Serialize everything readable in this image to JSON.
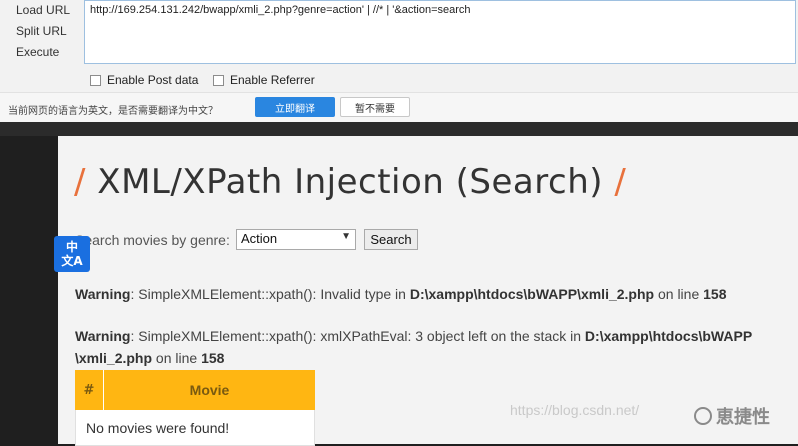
{
  "hackbar": {
    "actions": [
      "Load URL",
      "Split URL",
      "Execute"
    ],
    "url": "http://169.254.131.242/bwapp/xmli_2.php?genre=action' | //* | '&action=search",
    "options": [
      "Enable Post data",
      "Enable Referrer"
    ]
  },
  "translate_bar": {
    "prompt": "当前网页的语言为英文，是否需要翻译为中文？",
    "translate_button": "立即翻译",
    "not_now_button": "暂不需要"
  },
  "page": {
    "title": "XML/XPath Injection (Search)",
    "title_slash": "/",
    "search_label": "Search movies by genre:",
    "genre_selected": "Action",
    "search_button": "Search",
    "warnings": [
      {
        "label": "Warning",
        "message": ": SimpleXMLElement::xpath(): Invalid type in ",
        "path": "D:\\xampp\\htdocs\\bWAPP\\xmli_2.php",
        "on_line": " on line ",
        "line": "158"
      },
      {
        "label": "Warning",
        "message": ": SimpleXMLElement::xpath(): xmlXPathEval: 3 object left on the stack in ",
        "path_part1": "D:\\xampp\\htdocs\\bWAPP",
        "path_part2": "\\xmli_2.php",
        "on_line": " on line ",
        "line": "158"
      }
    ],
    "table": {
      "headers": [
        "#",
        "Movie"
      ],
      "empty_message": "No movies were found!"
    }
  },
  "translate_badge": {
    "top": "中",
    "bottom": "文A"
  },
  "watermark": {
    "url": "https://blog.csdn.net/",
    "logo_text": "恵捷性"
  },
  "colors": {
    "accent_orange": "#e8713c",
    "table_header": "#ffb612",
    "translate_blue": "#2a86e0",
    "badge_blue": "#1a6fe0"
  }
}
